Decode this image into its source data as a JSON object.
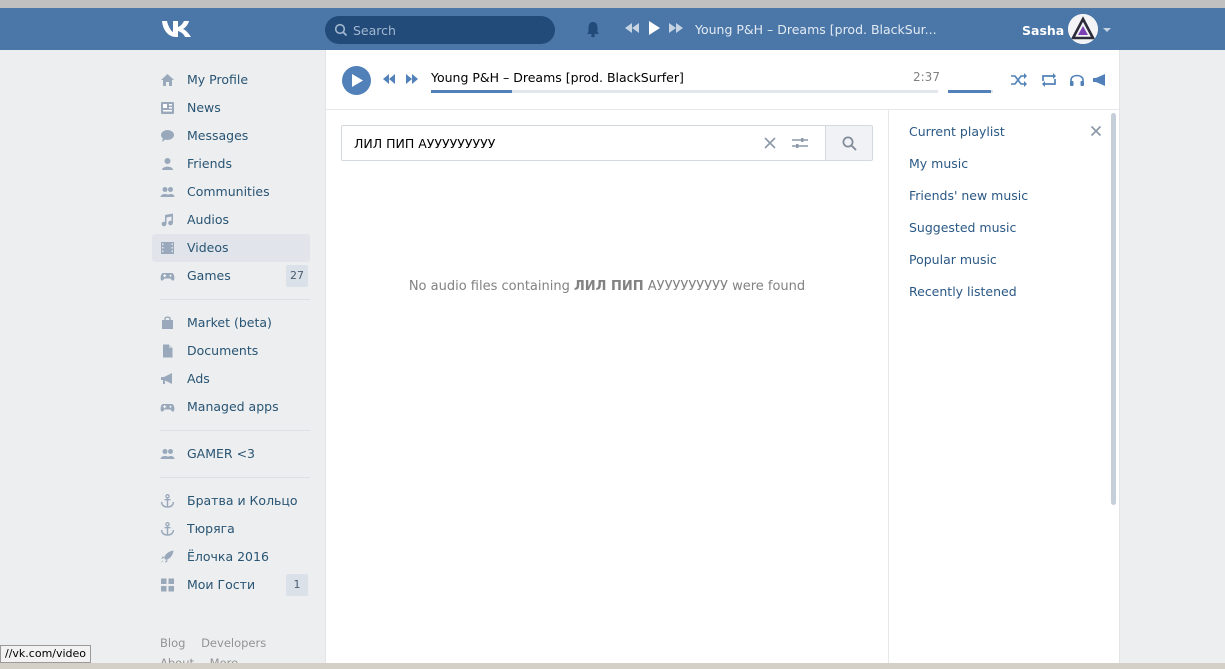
{
  "header": {
    "search_placeholder": "Search",
    "now_playing": "Young P&H – Dreams [prod. BlackSur...",
    "user_name": "Sasha"
  },
  "sidebar": {
    "items": [
      {
        "label": "My Profile",
        "icon": "home-icon"
      },
      {
        "label": "News",
        "icon": "news-icon"
      },
      {
        "label": "Messages",
        "icon": "messages-icon"
      },
      {
        "label": "Friends",
        "icon": "friend-icon"
      },
      {
        "label": "Communities",
        "icon": "communities-icon"
      },
      {
        "label": "Audios",
        "icon": "music-note-icon"
      },
      {
        "label": "Videos",
        "icon": "film-icon"
      },
      {
        "label": "Games",
        "icon": "gamepad-icon",
        "count": "27"
      },
      {
        "label": "Market (beta)",
        "icon": "bag-icon"
      },
      {
        "label": "Documents",
        "icon": "document-icon"
      },
      {
        "label": "Ads",
        "icon": "megaphone-icon"
      },
      {
        "label": "Managed apps",
        "icon": "gamepad-icon"
      },
      {
        "label": "GAMER <3",
        "icon": "communities-icon"
      },
      {
        "label": "Братва и Кольцо",
        "icon": "anchor-icon"
      },
      {
        "label": "Тюряга",
        "icon": "anchor-icon"
      },
      {
        "label": "Ёлочка 2016",
        "icon": "rocket-icon"
      },
      {
        "label": "Мои Гости",
        "icon": "grid-icon",
        "count": "1"
      }
    ],
    "footer": [
      "Blog",
      "Developers"
    ],
    "footer2": [
      "About",
      "More"
    ]
  },
  "player": {
    "track": "Young P&H – Dreams [prod. BlackSurfer]",
    "time": "2:37",
    "progress": 0.16,
    "volume": 0.95
  },
  "search": {
    "query": "ЛИЛ ПИП АУУУУУУУУУ"
  },
  "empty": {
    "prefix": "No audio files containing ",
    "query": "ЛИЛ ПИП",
    "mid": " АУУУУУУУУУ",
    "suffix": " were found"
  },
  "right_menu": [
    "Current playlist",
    "My music",
    "Friends' new music",
    "Suggested music",
    "Popular music",
    "Recently listened"
  ],
  "status_url": "//vk.com/video",
  "colors": {
    "brand": "#4a76a8",
    "link": "#2a5885",
    "accent": "#5181b8"
  }
}
